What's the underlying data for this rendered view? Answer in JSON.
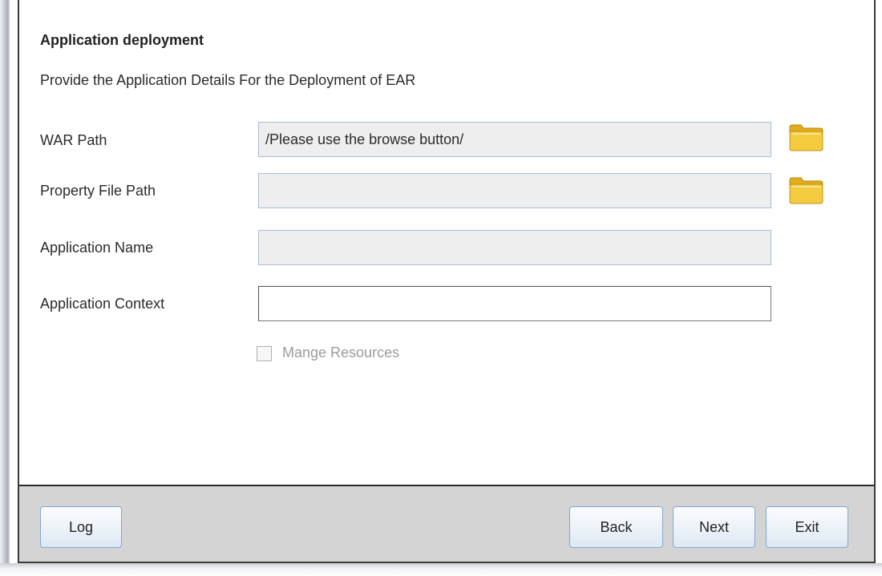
{
  "header": {
    "title": "Application deployment",
    "subtitle": "Provide the Application Details For the Deployment of EAR"
  },
  "form": {
    "war_path": {
      "label": "WAR Path",
      "value": "/Please use the browse button/"
    },
    "property_file_path": {
      "label": "Property File Path",
      "value": ""
    },
    "application_name": {
      "label": "Application Name",
      "value": ""
    },
    "application_context": {
      "label": "Application Context",
      "value": ""
    },
    "manage_resources": {
      "label": "Mange Resources",
      "checked": false,
      "enabled": false
    }
  },
  "icons": {
    "browse": "folder-icon"
  },
  "buttons": {
    "log": "Log",
    "back": "Back",
    "next": "Next",
    "exit": "Exit"
  },
  "colors": {
    "folder_fill": "#f2c53d",
    "button_border": "#7ea9d6",
    "readonly_field_bg": "#eeeeee",
    "disabled_text": "#9c9c9c"
  }
}
